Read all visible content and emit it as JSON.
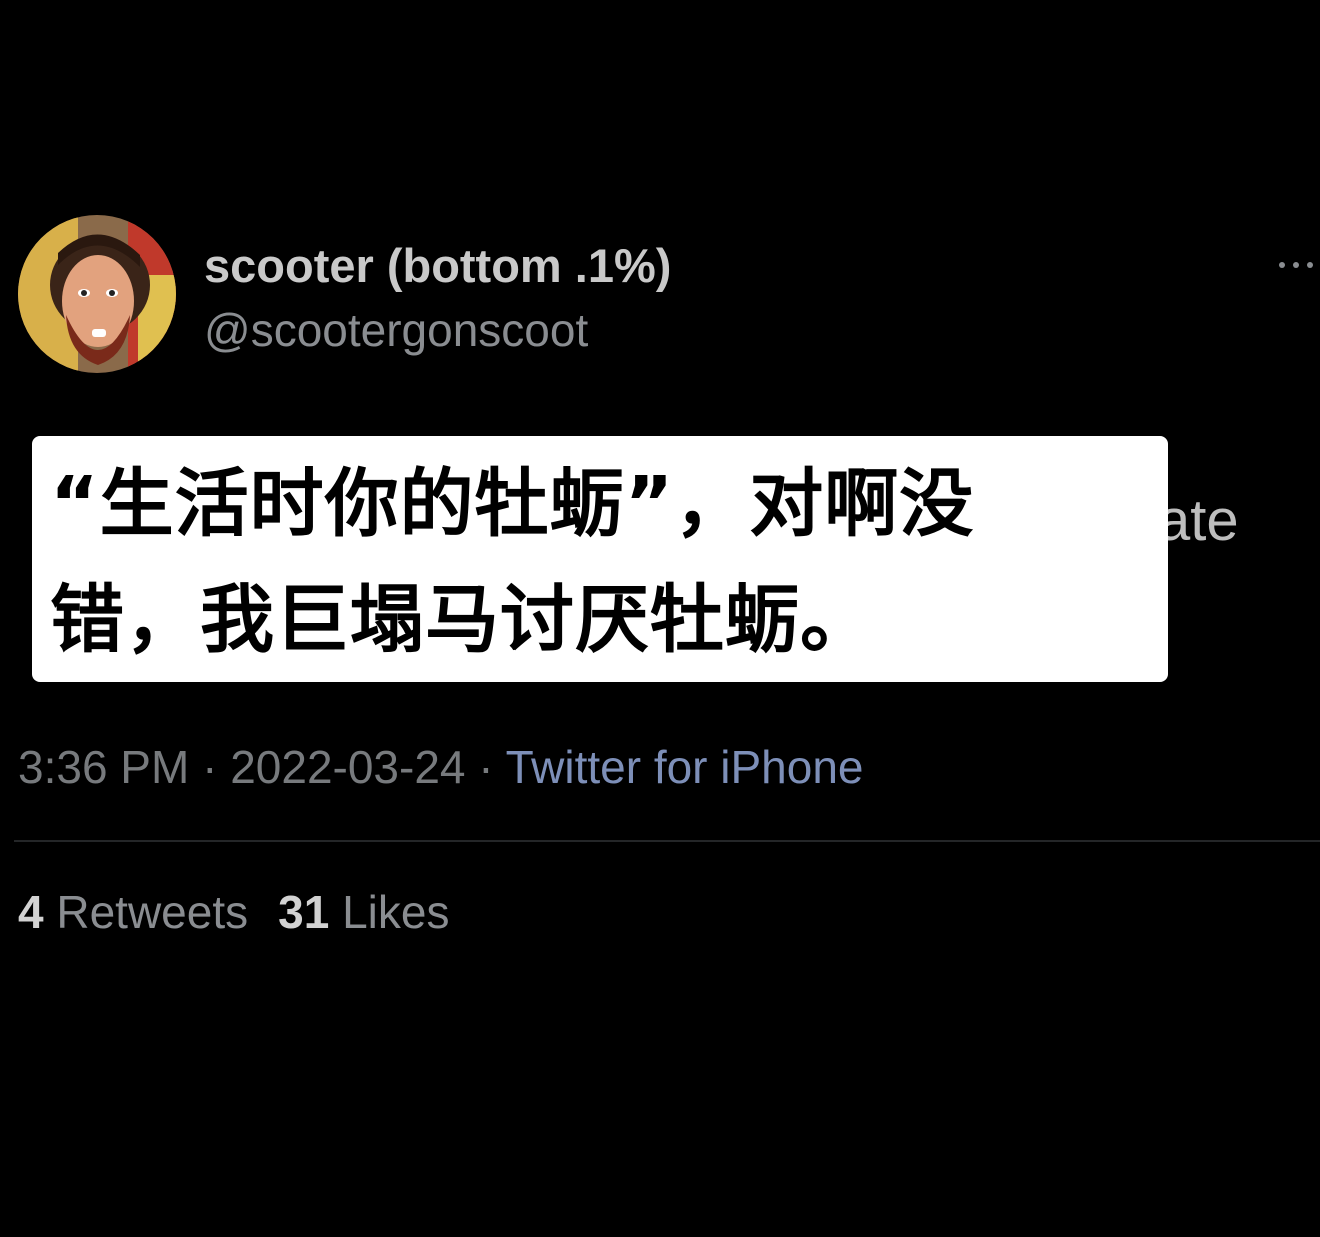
{
  "author": {
    "display_name": "scooter (bottom .1%)",
    "handle": "@scootergonscoot"
  },
  "tweet": {
    "visible_fragments": [
      "ate"
    ],
    "caption_overlay": [
      "“生活时你的牡蛎”，对啊没",
      "错，我巨塌马讨厌牡蛎。"
    ]
  },
  "meta": {
    "time": "3:36 PM",
    "separator": " · ",
    "date": "2022-03-24",
    "source": "Twitter for iPhone"
  },
  "stats": {
    "retweets_count": "4",
    "retweets_label": "Retweets",
    "likes_count": "31",
    "likes_label": "Likes"
  },
  "icons": {
    "more": "more-horizontal-icon"
  },
  "colors": {
    "background": "#000000",
    "caption_background": "#ffffff",
    "link_blue": "#7d8fb8"
  }
}
